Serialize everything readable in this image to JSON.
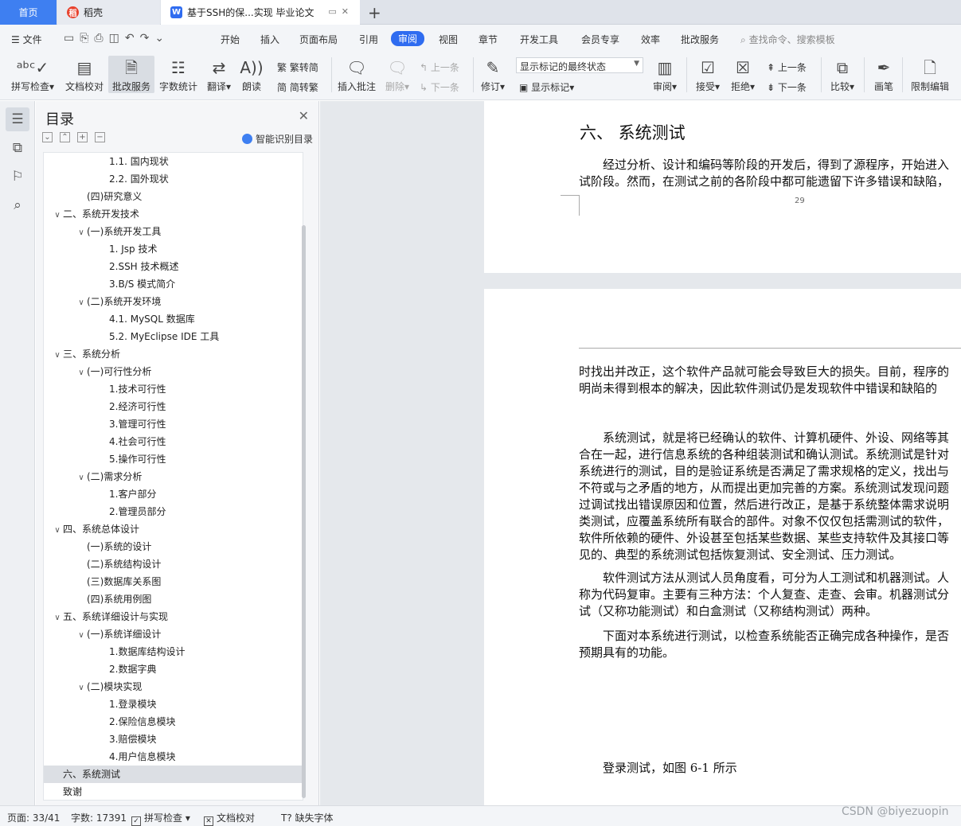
{
  "tabs": {
    "home": "首页",
    "shell": "稻壳",
    "doc": "基于SSH的保...实现 毕业论文",
    "add": "+"
  },
  "menu": {
    "file": "文件",
    "items": [
      "开始",
      "插入",
      "页面布局",
      "引用",
      "审阅",
      "视图",
      "章节",
      "开发工具",
      "会员专享",
      "效率",
      "批改服务"
    ],
    "active": "审阅",
    "search": "查找命令、搜索模板"
  },
  "ribbon": {
    "spell": "拼写检查",
    "proof": "文档校对",
    "grading": "批改服务",
    "wordcount": "字数统计",
    "translate": "翻译",
    "read": "朗读",
    "to_trad": "繁转简",
    "to_simp": "简转繁",
    "insert_comment": "插入批注",
    "delete": "删除",
    "prev": "上一条",
    "next": "下一条",
    "revise": "修订",
    "markup_state": "显示标记的最终状态",
    "show_markup": "显示标记",
    "review": "审阅",
    "accept": "接受",
    "reject": "拒绝",
    "prev2": "上一条",
    "next2": "下一条",
    "compare": "比较",
    "pen": "画笔",
    "restrict": "限制编辑"
  },
  "toc": {
    "title": "目录",
    "ai_label": "智能识别目录",
    "items": [
      {
        "label": "1.1. 国内现状",
        "level": 3,
        "arrow": ""
      },
      {
        "label": "2.2. 国外现状",
        "level": 3,
        "arrow": ""
      },
      {
        "label": "(四)研究意义",
        "level": 2,
        "arrow": ""
      },
      {
        "label": "二、系统开发技术",
        "level": 1,
        "arrow": "∨"
      },
      {
        "label": "(一)系统开发工具",
        "level": 2,
        "arrow": "∨"
      },
      {
        "label": "1. Jsp 技术",
        "level": 3,
        "arrow": ""
      },
      {
        "label": "2.SSH 技术概述",
        "level": 3,
        "arrow": ""
      },
      {
        "label": "3.B/S 模式简介",
        "level": 3,
        "arrow": ""
      },
      {
        "label": "(二)系统开发环境",
        "level": 2,
        "arrow": "∨"
      },
      {
        "label": "4.1. MySQL 数据库",
        "level": 3,
        "arrow": ""
      },
      {
        "label": "5.2. MyEclipse IDE 工具",
        "level": 3,
        "arrow": ""
      },
      {
        "label": "三、系统分析",
        "level": 1,
        "arrow": "∨"
      },
      {
        "label": "(一)可行性分析",
        "level": 2,
        "arrow": "∨"
      },
      {
        "label": "1.技术可行性",
        "level": 3,
        "arrow": ""
      },
      {
        "label": "2.经济可行性",
        "level": 3,
        "arrow": ""
      },
      {
        "label": "3.管理可行性",
        "level": 3,
        "arrow": ""
      },
      {
        "label": "4.社会可行性",
        "level": 3,
        "arrow": ""
      },
      {
        "label": "5.操作可行性",
        "level": 3,
        "arrow": ""
      },
      {
        "label": "(二)需求分析",
        "level": 2,
        "arrow": "∨"
      },
      {
        "label": "1.客户部分",
        "level": 3,
        "arrow": ""
      },
      {
        "label": "2.管理员部分",
        "level": 3,
        "arrow": ""
      },
      {
        "label": "四、系统总体设计",
        "level": 1,
        "arrow": "∨"
      },
      {
        "label": "(一)系统的设计",
        "level": 2,
        "arrow": ""
      },
      {
        "label": "(二)系统结构设计",
        "level": 2,
        "arrow": ""
      },
      {
        "label": "(三)数据库关系图",
        "level": 2,
        "arrow": ""
      },
      {
        "label": "(四)系统用例图",
        "level": 2,
        "arrow": ""
      },
      {
        "label": "五、系统详细设计与实现",
        "level": 1,
        "arrow": "∨"
      },
      {
        "label": "(一)系统详细设计",
        "level": 2,
        "arrow": "∨"
      },
      {
        "label": "1.数据库结构设计",
        "level": 3,
        "arrow": ""
      },
      {
        "label": "2.数据字典",
        "level": 3,
        "arrow": ""
      },
      {
        "label": "(二)模块实现",
        "level": 2,
        "arrow": "∨"
      },
      {
        "label": "1.登录模块",
        "level": 3,
        "arrow": ""
      },
      {
        "label": "2.保险信息模块",
        "level": 3,
        "arrow": ""
      },
      {
        "label": "3.赔偿模块",
        "level": 3,
        "arrow": ""
      },
      {
        "label": "4.用户信息模块",
        "level": 3,
        "arrow": ""
      },
      {
        "label": "六、系统测试",
        "level": 1,
        "arrow": "",
        "selected": true
      },
      {
        "label": "致谢",
        "level": 1,
        "arrow": ""
      }
    ]
  },
  "document": {
    "heading": "六、 系统测试",
    "page1_lines": [
      "　　经过分析、设计和编码等阶段的开发后，得到了源程序，开始进入",
      "试阶段。然而，在测试之前的各阶段中都可能遗留下许多错误和缺陷，"
    ],
    "page_number": "29",
    "p1_lines": [
      "时找出并改正，这个软件产品就可能会导致巨大的损失。目前，程序的",
      "明尚未得到根本的解决，因此软件测试仍是发现软件中错误和缺陷的"
    ],
    "p2_lines": [
      "　　系统测试，就是将已经确认的软件、计算机硬件、外设、网络等其",
      "合在一起，进行信息系统的各种组装测试和确认测试。系统测试是针对",
      "系统进行的测试，目的是验证系统是否满足了需求规格的定义，找出与",
      "不符或与之矛盾的地方，从而提出更加完善的方案。系统测试发现问题",
      "过调试找出错误原因和位置，然后进行改正，是基于系统整体需求说明",
      "类测试，应覆盖系统所有联合的部件。对象不仅仅包括需测试的软件，",
      "软件所依赖的硬件、外设甚至包括某些数据、某些支持软件及其接口等",
      "见的、典型的系统测试包括恢复测试、安全测试、压力测试。"
    ],
    "p3_lines": [
      "　　软件测试方法从测试人员角度看，可分为人工测试和机器测试。人",
      "称为代码复审。主要有三种方法：个人复查、走查、会审。机器测试分",
      "试（又称功能测试）和白盒测试（又称结构测试）两种。"
    ],
    "p4_lines": [
      "　　下面对本系统进行测试，以检查系统能否正确完成各种操作，是否",
      "预期具有的功能。"
    ],
    "p5": "　　登录测试，如图 6-1 所示"
  },
  "status": {
    "page": "页面: 33/41",
    "wordcount": "字数: 17391",
    "spell": "拼写检查",
    "proof": "文档校对",
    "missing_font": "缺失字体"
  },
  "watermark": "CSDN @biyezuopin",
  "colors": {
    "accent": "#3e7ff1",
    "active_menu": "#2f6cf0",
    "shell_icon": "#e8412c"
  }
}
